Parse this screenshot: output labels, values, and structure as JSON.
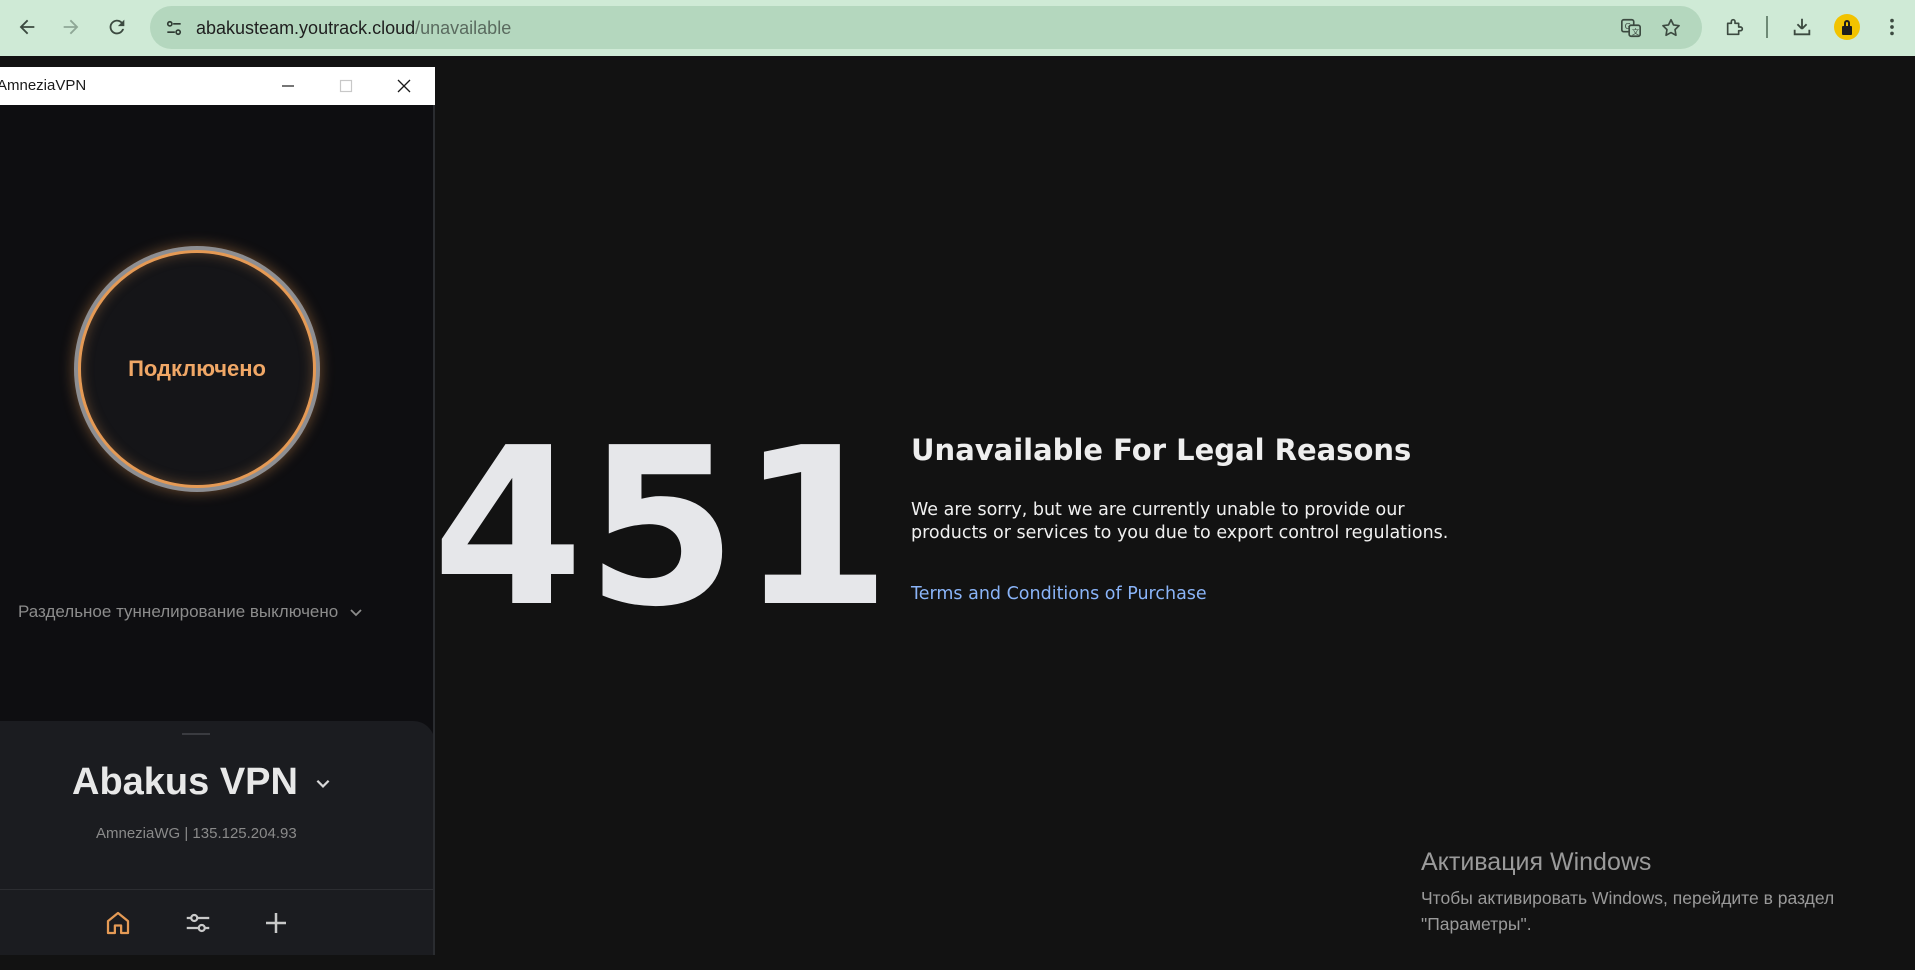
{
  "browser": {
    "url_host": "abakusteam.youtrack.cloud",
    "url_path": "/unavailable"
  },
  "page": {
    "code": "451",
    "title": "Unavailable For Legal Reasons",
    "message": "We are sorry, but we are currently unable to provide our products or services to you due to export control regulations.",
    "link": "Terms and Conditions of Purchase"
  },
  "windows_activation": {
    "title": "Активация Windows",
    "text": "Чтобы активировать Windows, перейдите в раздел \"Параметры\"."
  },
  "vpn": {
    "window_title": "AmneziaVPN",
    "status": "Подключено",
    "split_tunneling": "Раздельное туннелирование выключено",
    "server_name": "Abakus VPN",
    "server_info": "AmneziaWG | 135.125.204.93",
    "accent_color": "#e59a55"
  },
  "icons": [
    "back-icon",
    "forward-icon",
    "reload-icon",
    "site-info-icon",
    "translate-icon",
    "star-icon",
    "extensions-icon",
    "download-icon",
    "profile-icon",
    "menu-icon",
    "minimize-icon",
    "maximize-icon",
    "close-icon",
    "chevron-down-icon",
    "home-icon",
    "settings-icon",
    "add-icon"
  ]
}
